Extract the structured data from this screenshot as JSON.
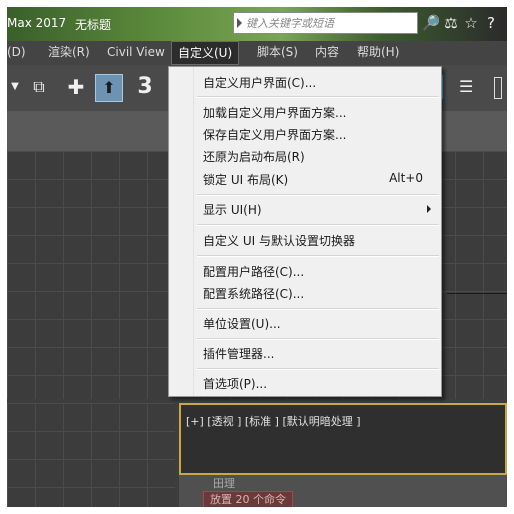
{
  "titlebar": {
    "app_title": "Max 2017",
    "doc_title": "无标题",
    "search_placeholder": "键入关键字或短语",
    "icons": [
      "binoculars-icon",
      "subscription-icon",
      "star-icon",
      "help-icon"
    ]
  },
  "menubar": {
    "items": [
      "(D)",
      "渲染(R)",
      "Civil View",
      "自定义(U)",
      "脚本(S)",
      "内容",
      "帮助(H)"
    ],
    "active": "自定义(U)"
  },
  "toolbar": {
    "icons": [
      "dropdown-arrow-icon",
      "link-bind-icon",
      "move-icon",
      "select-pointer-icon",
      "snap-3d-icon"
    ],
    "snap_label": "3"
  },
  "dropdown": {
    "items": [
      {
        "label": "自定义用户界面(C)...",
        "shortcut": "",
        "submenu": false
      },
      {
        "label": "加载自定义用户界面方案...",
        "shortcut": "",
        "submenu": false
      },
      {
        "label": "保存自定义用户界面方案...",
        "shortcut": "",
        "submenu": false
      },
      {
        "label": "还原为启动布局(R)",
        "shortcut": "",
        "submenu": false
      },
      {
        "label": "锁定 UI 布局(K)",
        "shortcut": "Alt+0",
        "submenu": false
      },
      {
        "label": "显示 UI(H)",
        "shortcut": "",
        "submenu": true
      },
      {
        "label": "自定义 UI 与默认设置切换器",
        "shortcut": "",
        "submenu": false
      },
      {
        "label": "配置用户路径(C)...",
        "shortcut": "",
        "submenu": false
      },
      {
        "label": "配置系统路径(C)...",
        "shortcut": "",
        "submenu": false
      },
      {
        "label": "单位设置(U)...",
        "shortcut": "",
        "submenu": false
      },
      {
        "label": "插件管理器...",
        "shortcut": "",
        "submenu": false
      },
      {
        "label": "首选项(P)...",
        "shortcut": "",
        "submenu": false
      }
    ]
  },
  "viewport": {
    "label": "[+] [透视 ] [标准 ] [默认明暗处理 ]"
  },
  "bottom": {
    "text1": "田理",
    "badge": "放置 20 个命令"
  }
}
